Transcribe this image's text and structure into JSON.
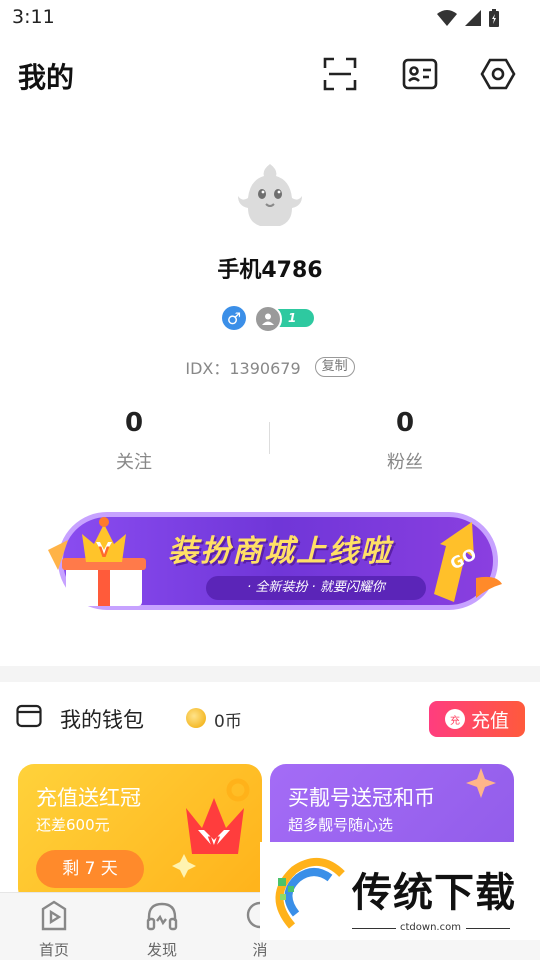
{
  "status_bar": {
    "time": "3:11"
  },
  "header": {
    "title": "我的"
  },
  "profile": {
    "username": "手机4786",
    "gender_symbol": "♂",
    "level": "1",
    "idx_text": "IDX：1390679",
    "copy_label": "复制"
  },
  "stats": {
    "following_value": "0",
    "following_label": "关注",
    "fans_value": "0",
    "fans_label": "粉丝"
  },
  "banner": {
    "title": "装扮商城上线啦",
    "subtitle": "· 全新装扮 · 就要闪耀你",
    "go_label": "GO",
    "crown_letter": "V"
  },
  "wallet": {
    "label": "我的钱包",
    "coin_count": "0币",
    "recharge_label": "充值",
    "recharge_icon_text": "充"
  },
  "cards": {
    "red_crown": {
      "title": "充值送红冠",
      "subtitle": "还差600元",
      "days": "剩 7 天",
      "crown_letter": "V"
    },
    "purple": {
      "title": "买靓号送冠和币",
      "subtitle": "超多靓号随心选"
    }
  },
  "tabs": [
    {
      "label": "首页"
    },
    {
      "label": "发现"
    },
    {
      "label": "消"
    }
  ],
  "watermark": {
    "text": "传统下载",
    "url": "ctdown.com"
  },
  "colors": {
    "accent_pink": "#ff3d7f",
    "banner_purple": "#7036d8",
    "level_green": "#2ec9a0",
    "gender_blue": "#3b8fe8",
    "card_yellow": "#ffc62a",
    "card_purple": "#9a63f0"
  }
}
